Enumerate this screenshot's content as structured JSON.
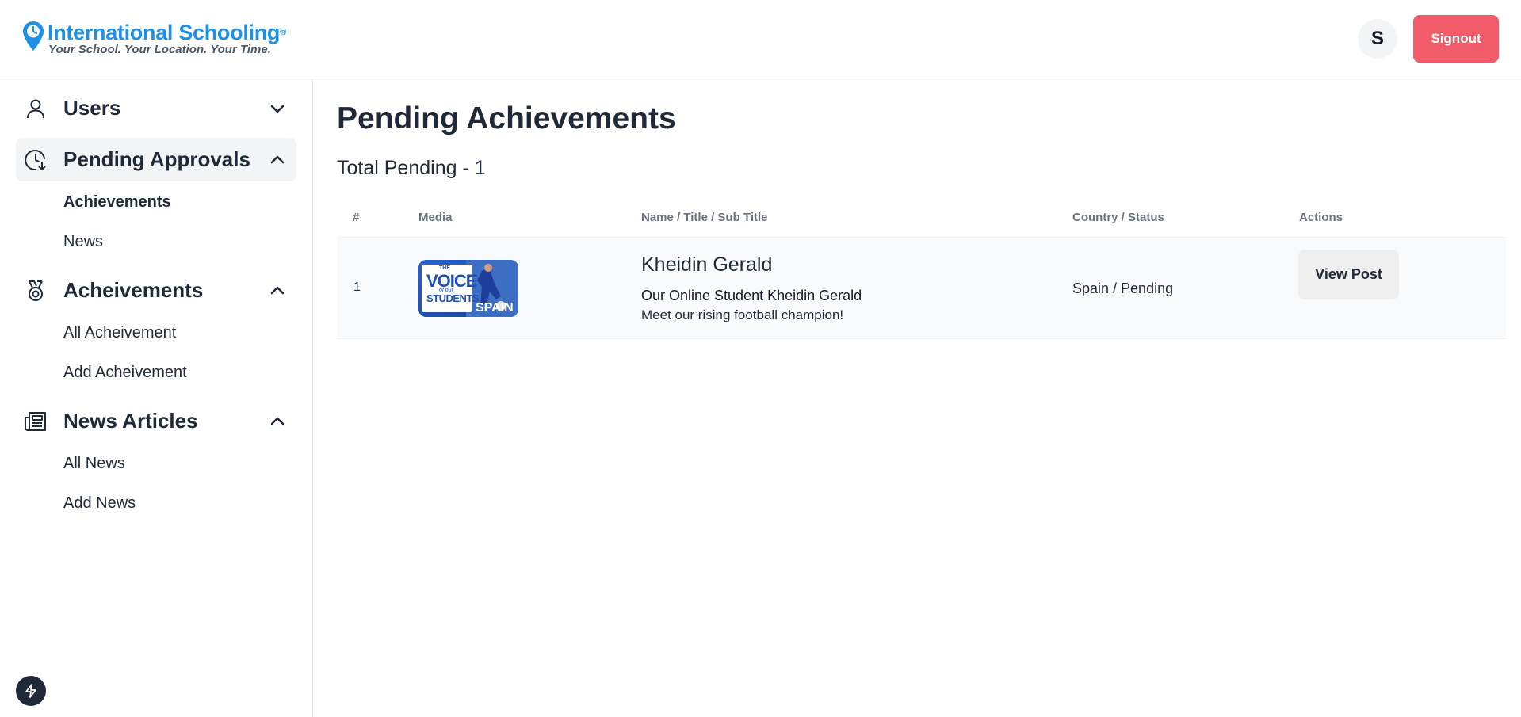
{
  "header": {
    "logo_name": "International Schooling",
    "logo_reg": "®",
    "logo_tagline": "Your School. Your Location. Your Time.",
    "avatar_initial": "S",
    "signout_label": "Signout"
  },
  "sidebar": {
    "groups": [
      {
        "label": "Users",
        "icon": "user-icon",
        "expanded": false
      },
      {
        "label": "Pending Approvals",
        "icon": "clock-icon",
        "expanded": true,
        "items": [
          "Achievements",
          "News"
        ],
        "active_item": "Achievements"
      },
      {
        "label": "Acheivements",
        "icon": "medal-icon",
        "expanded": true,
        "items": [
          "All Acheivement",
          "Add Acheivement"
        ]
      },
      {
        "label": "News Articles",
        "icon": "newspaper-icon",
        "expanded": true,
        "items": [
          "All News",
          "Add News"
        ]
      }
    ]
  },
  "main": {
    "title": "Pending Achievements",
    "total_label": "Total Pending - 1",
    "columns": [
      "#",
      "Media",
      "Name / Title / Sub Title",
      "Country / Status",
      "Actions"
    ],
    "rows": [
      {
        "index": "1",
        "media_text_top": "THE",
        "media_text_main": "VOICE",
        "media_text_of": "of our",
        "media_text_students": "STUDENTS",
        "media_text_country": "SPAIN",
        "name": "Kheidin Gerald",
        "title": "Our Online Student Kheidin Gerald",
        "subtitle": "Meet our rising football champion!",
        "country_status": "Spain / Pending",
        "action_label": "View Post"
      }
    ]
  },
  "colors": {
    "brand": "#1e90e6",
    "signout": "#f25c6a",
    "text": "#1f2937"
  }
}
